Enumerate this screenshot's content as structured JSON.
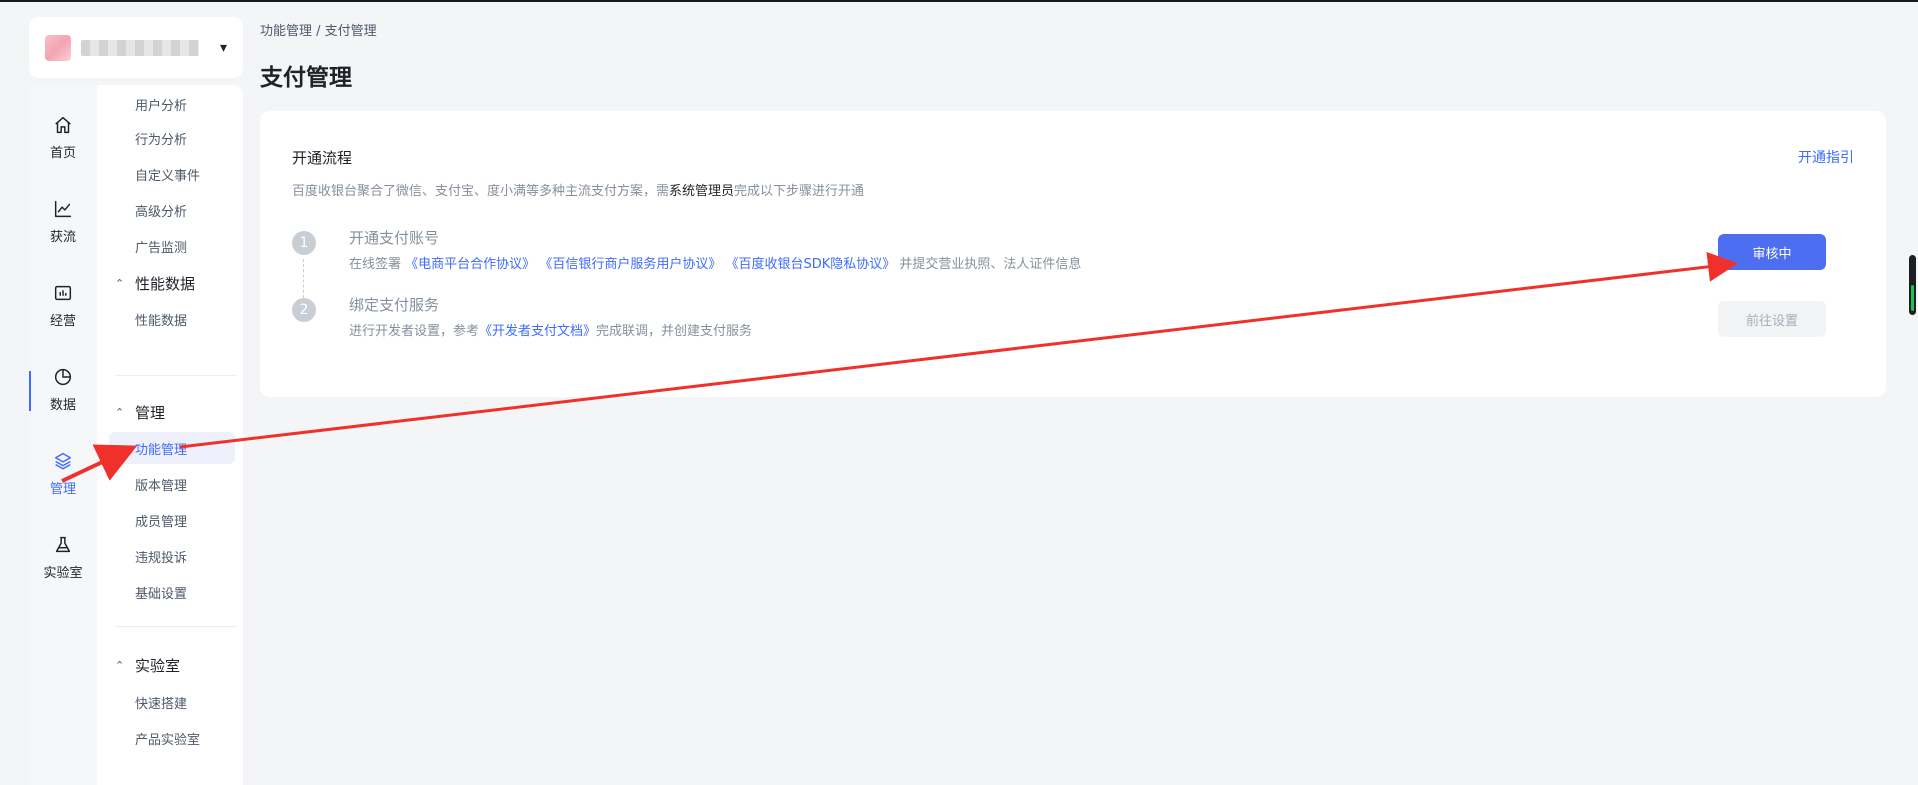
{
  "app": {
    "name": ""
  },
  "rail": {
    "items": [
      {
        "label": "首页",
        "icon": "home-icon",
        "active": false
      },
      {
        "label": "获流",
        "icon": "trend-icon",
        "active": false
      },
      {
        "label": "经营",
        "icon": "board-icon",
        "active": false
      },
      {
        "label": "数据",
        "icon": "pie-icon",
        "active": false
      },
      {
        "label": "管理",
        "icon": "layers-icon",
        "active": true
      },
      {
        "label": "实验室",
        "icon": "flask-icon",
        "active": false
      }
    ]
  },
  "submenu": {
    "clipped_item": "用户分析",
    "analysis_items": [
      "行为分析",
      "自定义事件",
      "高级分析",
      "广告监测"
    ],
    "perf_group": "性能数据",
    "perf_items": [
      "性能数据"
    ],
    "manage_group": "管理",
    "manage_items": [
      "功能管理",
      "版本管理",
      "成员管理",
      "违规投诉",
      "基础设置"
    ],
    "lab_group": "实验室",
    "lab_items": [
      "快速搭建",
      "产品实验室"
    ]
  },
  "breadcrumb": {
    "parent": "功能管理",
    "separator": " / ",
    "current": "支付管理"
  },
  "page": {
    "title": "支付管理"
  },
  "card": {
    "title": "开通流程",
    "guide_link": "开通指引",
    "desc_prefix": "百度收银台聚合了微信、支付宝、度小满等多种主流支付方案，需",
    "desc_bold": "系统管理员",
    "desc_suffix": "完成以下步骤进行开通",
    "steps": [
      {
        "number": "1",
        "title": "开通支付账号",
        "desc_prefix": "在线签署",
        "links": [
          "《电商平台合作协议》",
          "《百信银行商户服务用户协议》",
          "《百度收银台SDK隐私协议》"
        ],
        "desc_suffix": " 并提交营业执照、法人证件信息",
        "button": "审核中"
      },
      {
        "number": "2",
        "title": "绑定支付服务",
        "desc_prefix": "进行开发者设置，参考",
        "link": "《开发者支付文档》",
        "desc_suffix": "完成联调，并创建支付服务",
        "button": "前往设置"
      }
    ]
  },
  "colors": {
    "accent": "#3f6bff",
    "button": "#4e6ef2",
    "annotation": "#f0302a"
  }
}
